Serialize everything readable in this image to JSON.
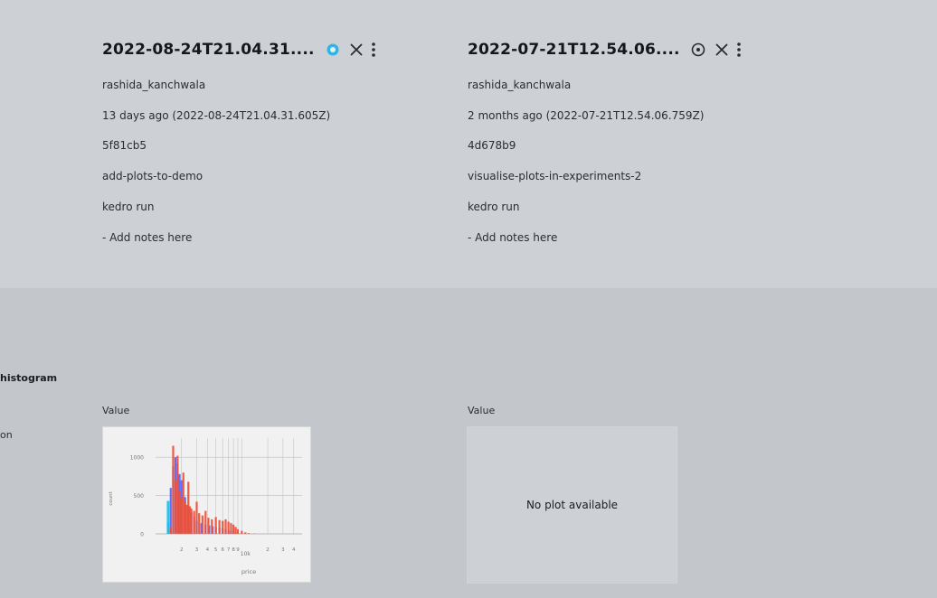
{
  "runs": [
    {
      "title": "2022-08-24T21.04.31....",
      "pinned": true,
      "author": "rashida_kanchwala",
      "time": "13 days ago (2022-08-24T21.04.31.605Z)",
      "git_sha": "5f81cb5",
      "branch": "add-plots-to-demo",
      "command": "kedro run",
      "notes": "- Add notes here"
    },
    {
      "title": "2022-07-21T12.54.06....",
      "pinned": false,
      "author": "rashida_kanchwala",
      "time": "2 months ago (2022-07-21T12.54.06.759Z)",
      "git_sha": "4d678b9",
      "branch": "visualise-plots-in-experiments-2",
      "command": "kedro run",
      "notes": "- Add notes here"
    }
  ],
  "plots_section": {
    "section_title": "histogram",
    "row_label": "on",
    "value_header": "Value",
    "no_plot_text": "No plot available"
  },
  "chart_data": {
    "type": "bar",
    "title": "",
    "xlabel": "price",
    "ylabel": "count",
    "x_scale": "log",
    "xlim": [
      1000,
      50000
    ],
    "ylim": [
      0,
      1250
    ],
    "y_ticks": [
      "0",
      "500",
      "1000"
    ],
    "x_tick_labels": [
      "2",
      "3",
      "4",
      "5",
      "6",
      "7",
      "8",
      "9",
      "10k",
      "2",
      "3",
      "4"
    ],
    "series": [
      {
        "color": "#5b63f5",
        "x": [
          1400,
          1500,
          1600,
          1700,
          1800,
          1900,
          2000,
          2200,
          2400,
          2600,
          2800,
          3000,
          3400,
          3800,
          4200,
          4600,
          5000,
          5500,
          6000,
          6500,
          7000,
          7500,
          8000,
          9000,
          10000,
          12000,
          14000
        ],
        "values": [
          150,
          600,
          880,
          1000,
          920,
          780,
          700,
          480,
          360,
          280,
          220,
          170,
          140,
          120,
          110,
          100,
          90,
          80,
          70,
          60,
          50,
          40,
          30,
          20,
          12,
          6,
          3
        ]
      },
      {
        "color": "#ee4f37",
        "x": [
          1500,
          1600,
          1700,
          1800,
          1900,
          2000,
          2100,
          2200,
          2300,
          2400,
          2500,
          2600,
          2800,
          3000,
          3200,
          3500,
          3800,
          4100,
          4500,
          5000,
          5500,
          6000,
          6500,
          7000,
          7500,
          8000,
          8500,
          9000,
          10000,
          11000,
          12000,
          14000
        ],
        "values": [
          80,
          1150,
          700,
          1020,
          560,
          470,
          800,
          430,
          380,
          680,
          360,
          330,
          300,
          420,
          270,
          240,
          300,
          210,
          190,
          220,
          180,
          170,
          190,
          160,
          140,
          120,
          90,
          60,
          40,
          20,
          10,
          4
        ]
      },
      {
        "color": "#19c2e8",
        "x": [
          1400
        ],
        "values": [
          430
        ]
      }
    ]
  }
}
